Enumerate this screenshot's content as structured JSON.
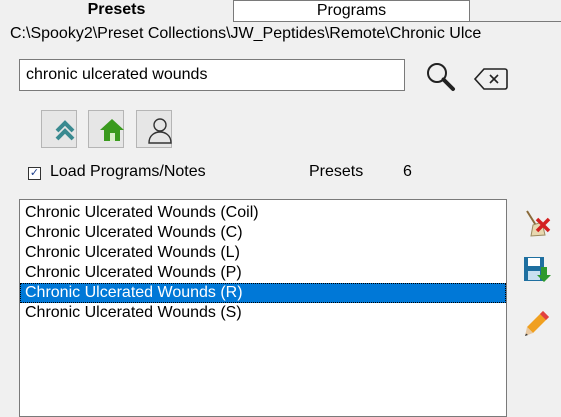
{
  "tabs": [
    {
      "label": "Presets",
      "active": true
    },
    {
      "label": "Programs",
      "active": false
    }
  ],
  "path": "C:\\Spooky2\\Preset Collections\\JW_Peptides\\Remote\\Chronic Ulce",
  "search": {
    "value": "chronic ulcerated wounds"
  },
  "icons": {
    "search": "magnifier-icon",
    "clear": "backspace-icon",
    "up": "double-chevron-up-icon",
    "home": "home-icon",
    "user": "user-icon",
    "delete": "broom-x-icon",
    "save": "save-floppy-icon",
    "edit": "pencil-icon"
  },
  "options": {
    "load_programs_label": "Load Programs/Notes",
    "load_programs_checked": true
  },
  "presets": {
    "label": "Presets",
    "count": "6"
  },
  "list": {
    "items": [
      "Chronic Ulcerated Wounds (Coil)",
      "Chronic Ulcerated Wounds (C)",
      "Chronic Ulcerated Wounds (L)",
      "Chronic Ulcerated Wounds (P)",
      "Chronic Ulcerated Wounds (R)",
      "Chronic Ulcerated Wounds (S)"
    ],
    "selected_index": 4
  },
  "colors": {
    "selection": "#0078d7",
    "home_green": "#3a9a1e",
    "up_teal": "#3a8a90",
    "pencil_orange": "#f0a020"
  }
}
